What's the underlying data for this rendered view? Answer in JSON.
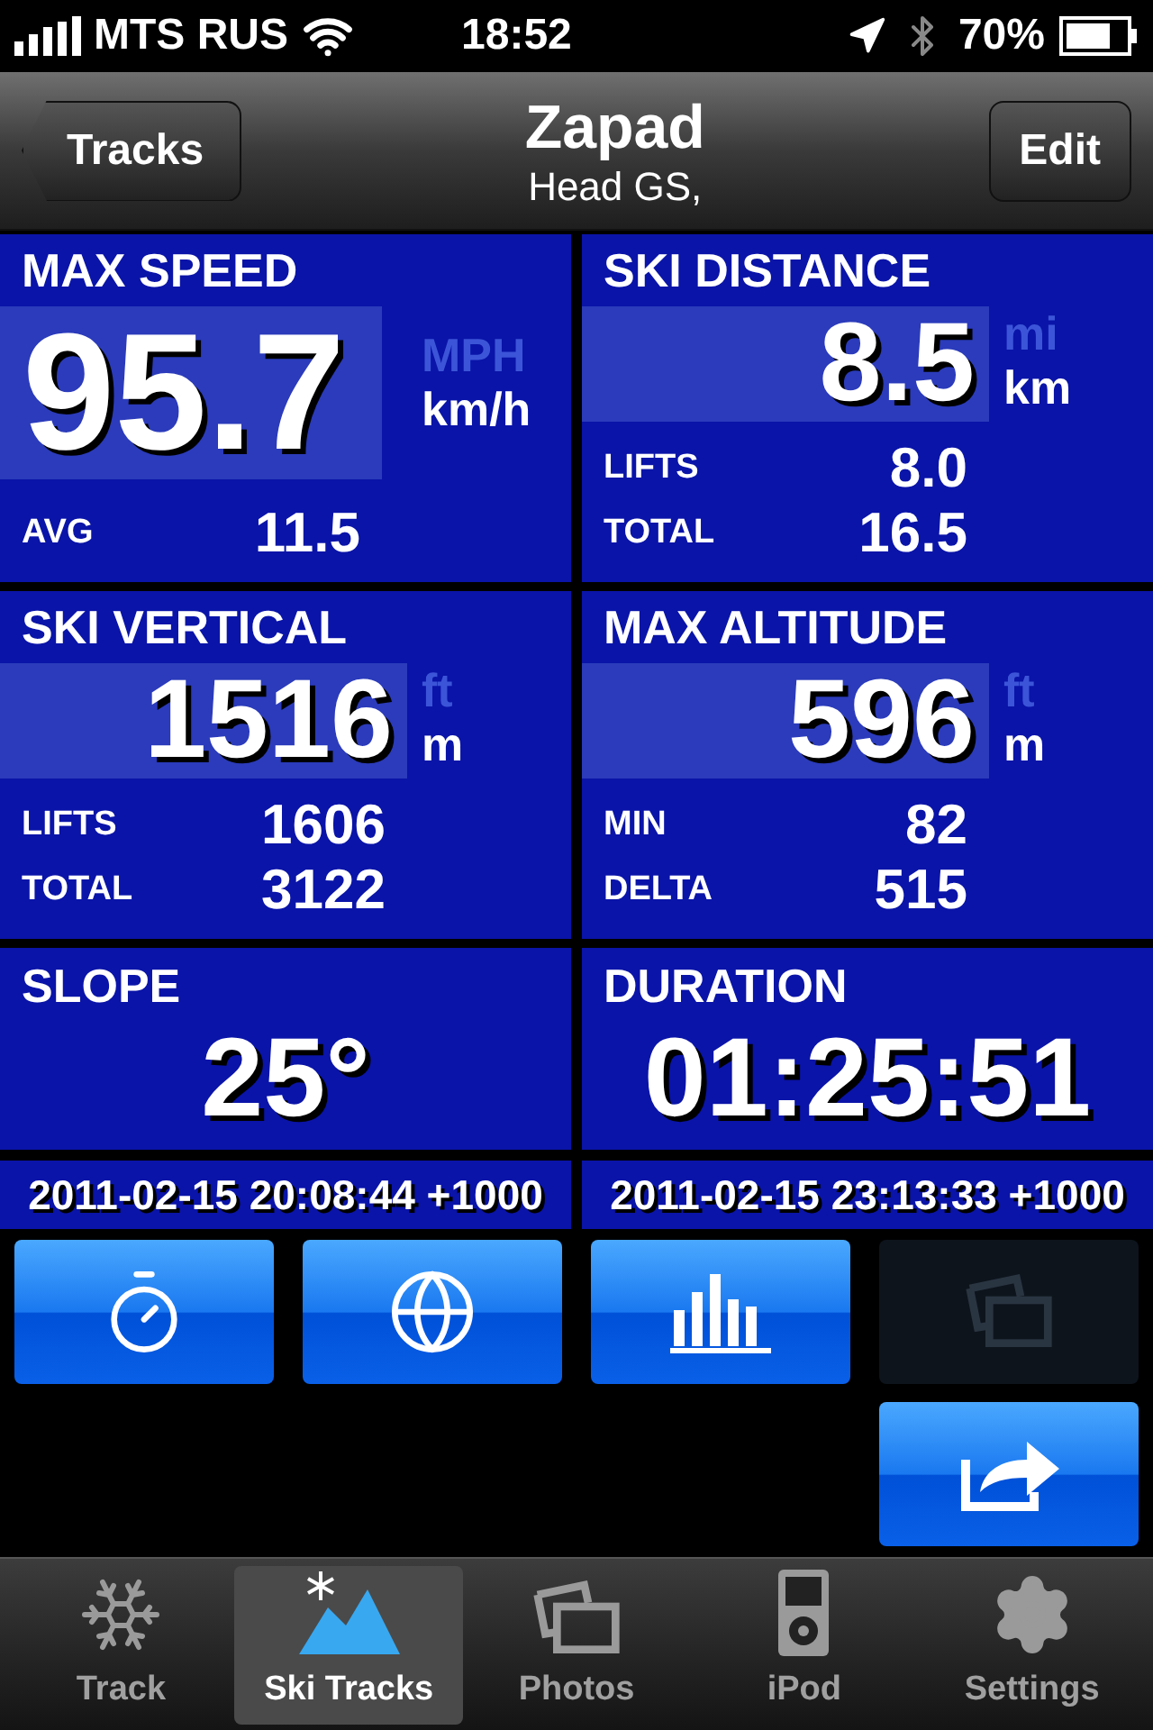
{
  "status_bar": {
    "carrier": "MTS RUS",
    "time": "18:52",
    "battery": "70%"
  },
  "nav": {
    "back": "Tracks",
    "title": "Zapad",
    "subtitle": "Head GS,",
    "action": "Edit"
  },
  "cards": [
    {
      "kind": "featured",
      "title": "MAX SPEED",
      "value": "95.7",
      "units": [
        {
          "label": "MPH",
          "selected": false
        },
        {
          "label": "km/h",
          "selected": true
        }
      ],
      "rows": [
        {
          "label": "AVG",
          "value": "11.5"
        }
      ]
    },
    {
      "kind": "metric",
      "title": "SKI DISTANCE",
      "value": "8.5",
      "units": [
        {
          "label": "mi",
          "selected": false
        },
        {
          "label": "km",
          "selected": true
        }
      ],
      "rows": [
        {
          "label": "LIFTS",
          "value": "8.0"
        },
        {
          "label": "TOTAL",
          "value": "16.5"
        }
      ]
    },
    {
      "kind": "metric",
      "title": "SKI VERTICAL",
      "value": "1516",
      "units": [
        {
          "label": "ft",
          "selected": false
        },
        {
          "label": "m",
          "selected": true
        }
      ],
      "rows": [
        {
          "label": "LIFTS",
          "value": "1606"
        },
        {
          "label": "TOTAL",
          "value": "3122"
        }
      ]
    },
    {
      "kind": "metric",
      "title": "MAX ALTITUDE",
      "value": "596",
      "units": [
        {
          "label": "ft",
          "selected": false
        },
        {
          "label": "m",
          "selected": true
        }
      ],
      "rows": [
        {
          "label": "MIN",
          "value": "82"
        },
        {
          "label": "DELTA",
          "value": "515"
        }
      ]
    },
    {
      "kind": "plain",
      "title": "SLOPE",
      "value": "25°"
    },
    {
      "kind": "plain",
      "title": "DURATION",
      "value": "01:25:51"
    }
  ],
  "timestamps": [
    "2011-02-15 20:08:44 +1000",
    "2011-02-15 23:13:33 +1000"
  ],
  "actions": [
    {
      "kind": "stopwatch",
      "disabled": false
    },
    {
      "kind": "globe",
      "disabled": false
    },
    {
      "kind": "chart",
      "disabled": false
    },
    {
      "kind": "photos",
      "disabled": true
    },
    {
      "kind": "share",
      "disabled": false
    }
  ],
  "tabs": [
    {
      "kind": "snowflake",
      "label": "Track",
      "selected": false
    },
    {
      "kind": "mountain",
      "label": "Ski Tracks",
      "selected": true
    },
    {
      "kind": "photos",
      "label": "Photos",
      "selected": false
    },
    {
      "kind": "ipod",
      "label": "iPod",
      "selected": false
    },
    {
      "kind": "gear",
      "label": "Settings",
      "selected": false
    }
  ]
}
